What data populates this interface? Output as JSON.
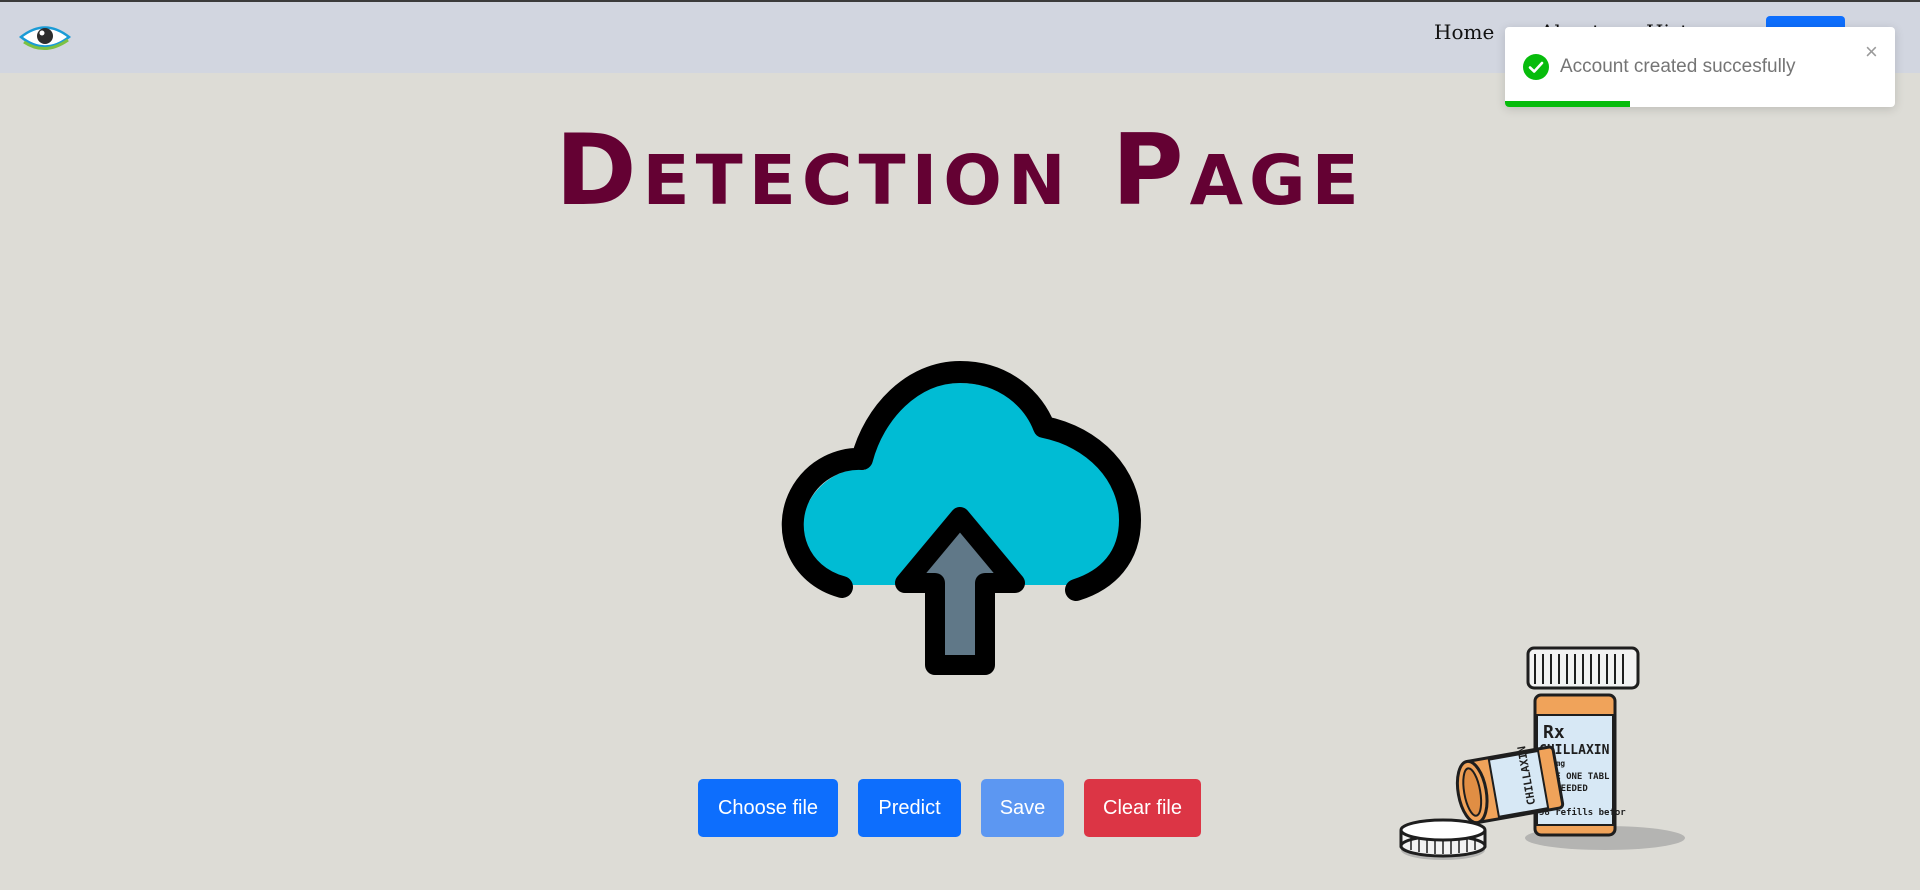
{
  "navbar": {
    "logo": "eye-logo",
    "links": [
      {
        "label": "Home"
      },
      {
        "label": "About"
      },
      {
        "label": "History"
      }
    ],
    "button_label": ""
  },
  "toast": {
    "type": "success",
    "message": "Account created succesfully",
    "close_symbol": "×",
    "progress": 0.32,
    "accent_color": "#07bc0c"
  },
  "main": {
    "title": "Detection Page",
    "upload_icon": "cloud-upload-icon",
    "buttons": {
      "choose": "Choose file",
      "predict": "Predict",
      "save": "Save",
      "clear": "Clear file"
    }
  },
  "illustration": {
    "name": "pill-bottles",
    "rx": "Rx",
    "drug": "CHILLAXIN",
    "dose": "400mg",
    "directions_1": "TAKE ONE TABL",
    "directions_2": "AS NEEDED",
    "refills": "58 refills befor",
    "side_label": "CHILLAXIN"
  },
  "colors": {
    "primary": "#0d6efd",
    "danger": "#dc3545",
    "title": "#640133",
    "background": "#dddcd6",
    "navbar": "#d2d6e0"
  }
}
